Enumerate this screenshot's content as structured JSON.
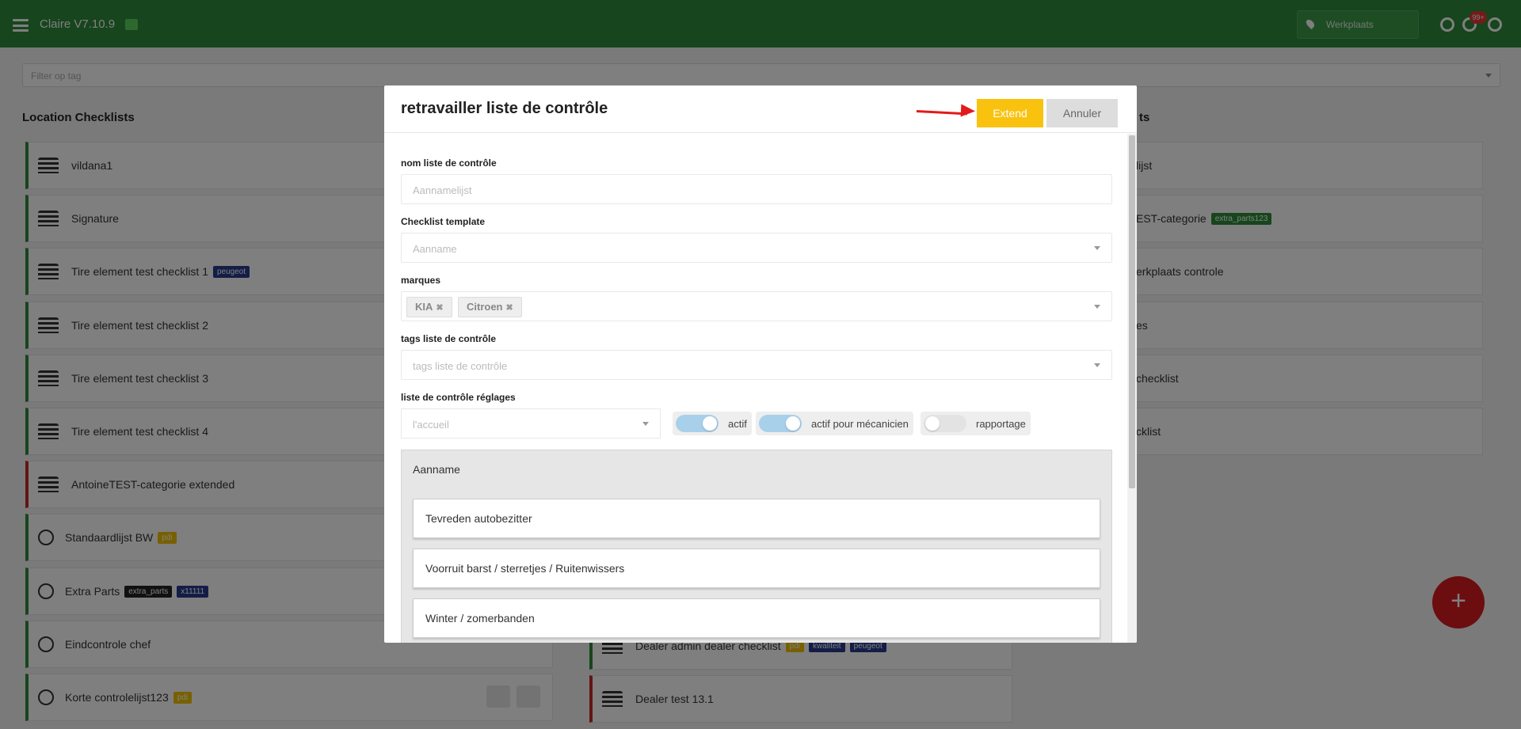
{
  "app": {
    "title": "Claire V7.10.9",
    "location": "Werkplaats",
    "notification_count": "99+"
  },
  "filter": {
    "placeholder": "Filter op tag"
  },
  "sections": {
    "left_title": "Location Checklists",
    "right_title_suffix": "ts"
  },
  "left_list": [
    {
      "label": "vildana1",
      "icon": "building-icon",
      "tags": []
    },
    {
      "label": "Signature",
      "icon": "building-icon",
      "tags": []
    },
    {
      "label": "Tire element test checklist 1",
      "icon": "building-icon",
      "tags": [
        "peugeot"
      ]
    },
    {
      "label": "Tire element test checklist 2",
      "icon": "building-icon",
      "tags": []
    },
    {
      "label": "Tire element test checklist 3",
      "icon": "building-icon",
      "tags": []
    },
    {
      "label": "Tire element test checklist 4",
      "icon": "building-icon",
      "tags": []
    },
    {
      "label": "AntoineTEST-categorie extended",
      "icon": "building-icon",
      "tags": []
    },
    {
      "label": "Standaardlijst BW",
      "icon": "globe-icon",
      "tags": [
        "pdi"
      ]
    },
    {
      "label": "Extra Parts",
      "icon": "globe-icon",
      "tags": [
        "extra_parts",
        "x11111"
      ]
    },
    {
      "label": "Eindcontrole chef",
      "icon": "globe-icon",
      "tags": []
    },
    {
      "label": "Korte controlelijst123",
      "icon": "globe-icon",
      "tags": [
        "pdi"
      ]
    }
  ],
  "middle_list": [
    {
      "label": "Dealer admin dealer checklist",
      "tags": [
        "pdi",
        "kwaliteit",
        "peugeot"
      ]
    },
    {
      "label": "Dealer test 13.1",
      "tags": []
    }
  ],
  "right_list": [
    {
      "label": "lijst",
      "tags": []
    },
    {
      "label": "EST-categorie",
      "tags": [
        "extra_parts123"
      ]
    },
    {
      "label": "erkplaats controle",
      "tags": []
    },
    {
      "label": "es",
      "tags": []
    },
    {
      "label": "checklist",
      "tags": []
    },
    {
      "label": "cklist",
      "tags": []
    }
  ],
  "fab": {
    "label": "+"
  },
  "modal": {
    "title": "retravailler liste de contrôle",
    "extend_label": "Extend",
    "cancel_label": "Annuler",
    "name_label": "nom liste de contrôle",
    "name_placeholder": "Aannamelijst",
    "template_label": "Checklist template",
    "template_placeholder": "Aanname",
    "brands_label": "marques",
    "brands": [
      "KIA",
      "Citroen"
    ],
    "tags_label": "tags liste de contrôle",
    "tags_placeholder": "tags liste de contrôle",
    "settings_label": "liste de contrôle réglages",
    "home_placeholder": "l'accueil",
    "toggles": [
      {
        "label": "actif",
        "on": true
      },
      {
        "label": "actif pour mécanicien",
        "on": true
      },
      {
        "label": "rapportage",
        "on": false
      }
    ],
    "group_title": "Aanname",
    "items": [
      "Tevreden autobezitter",
      "Voorruit barst / sterretjes / Ruitenwissers",
      "Winter / zomerbanden"
    ]
  }
}
